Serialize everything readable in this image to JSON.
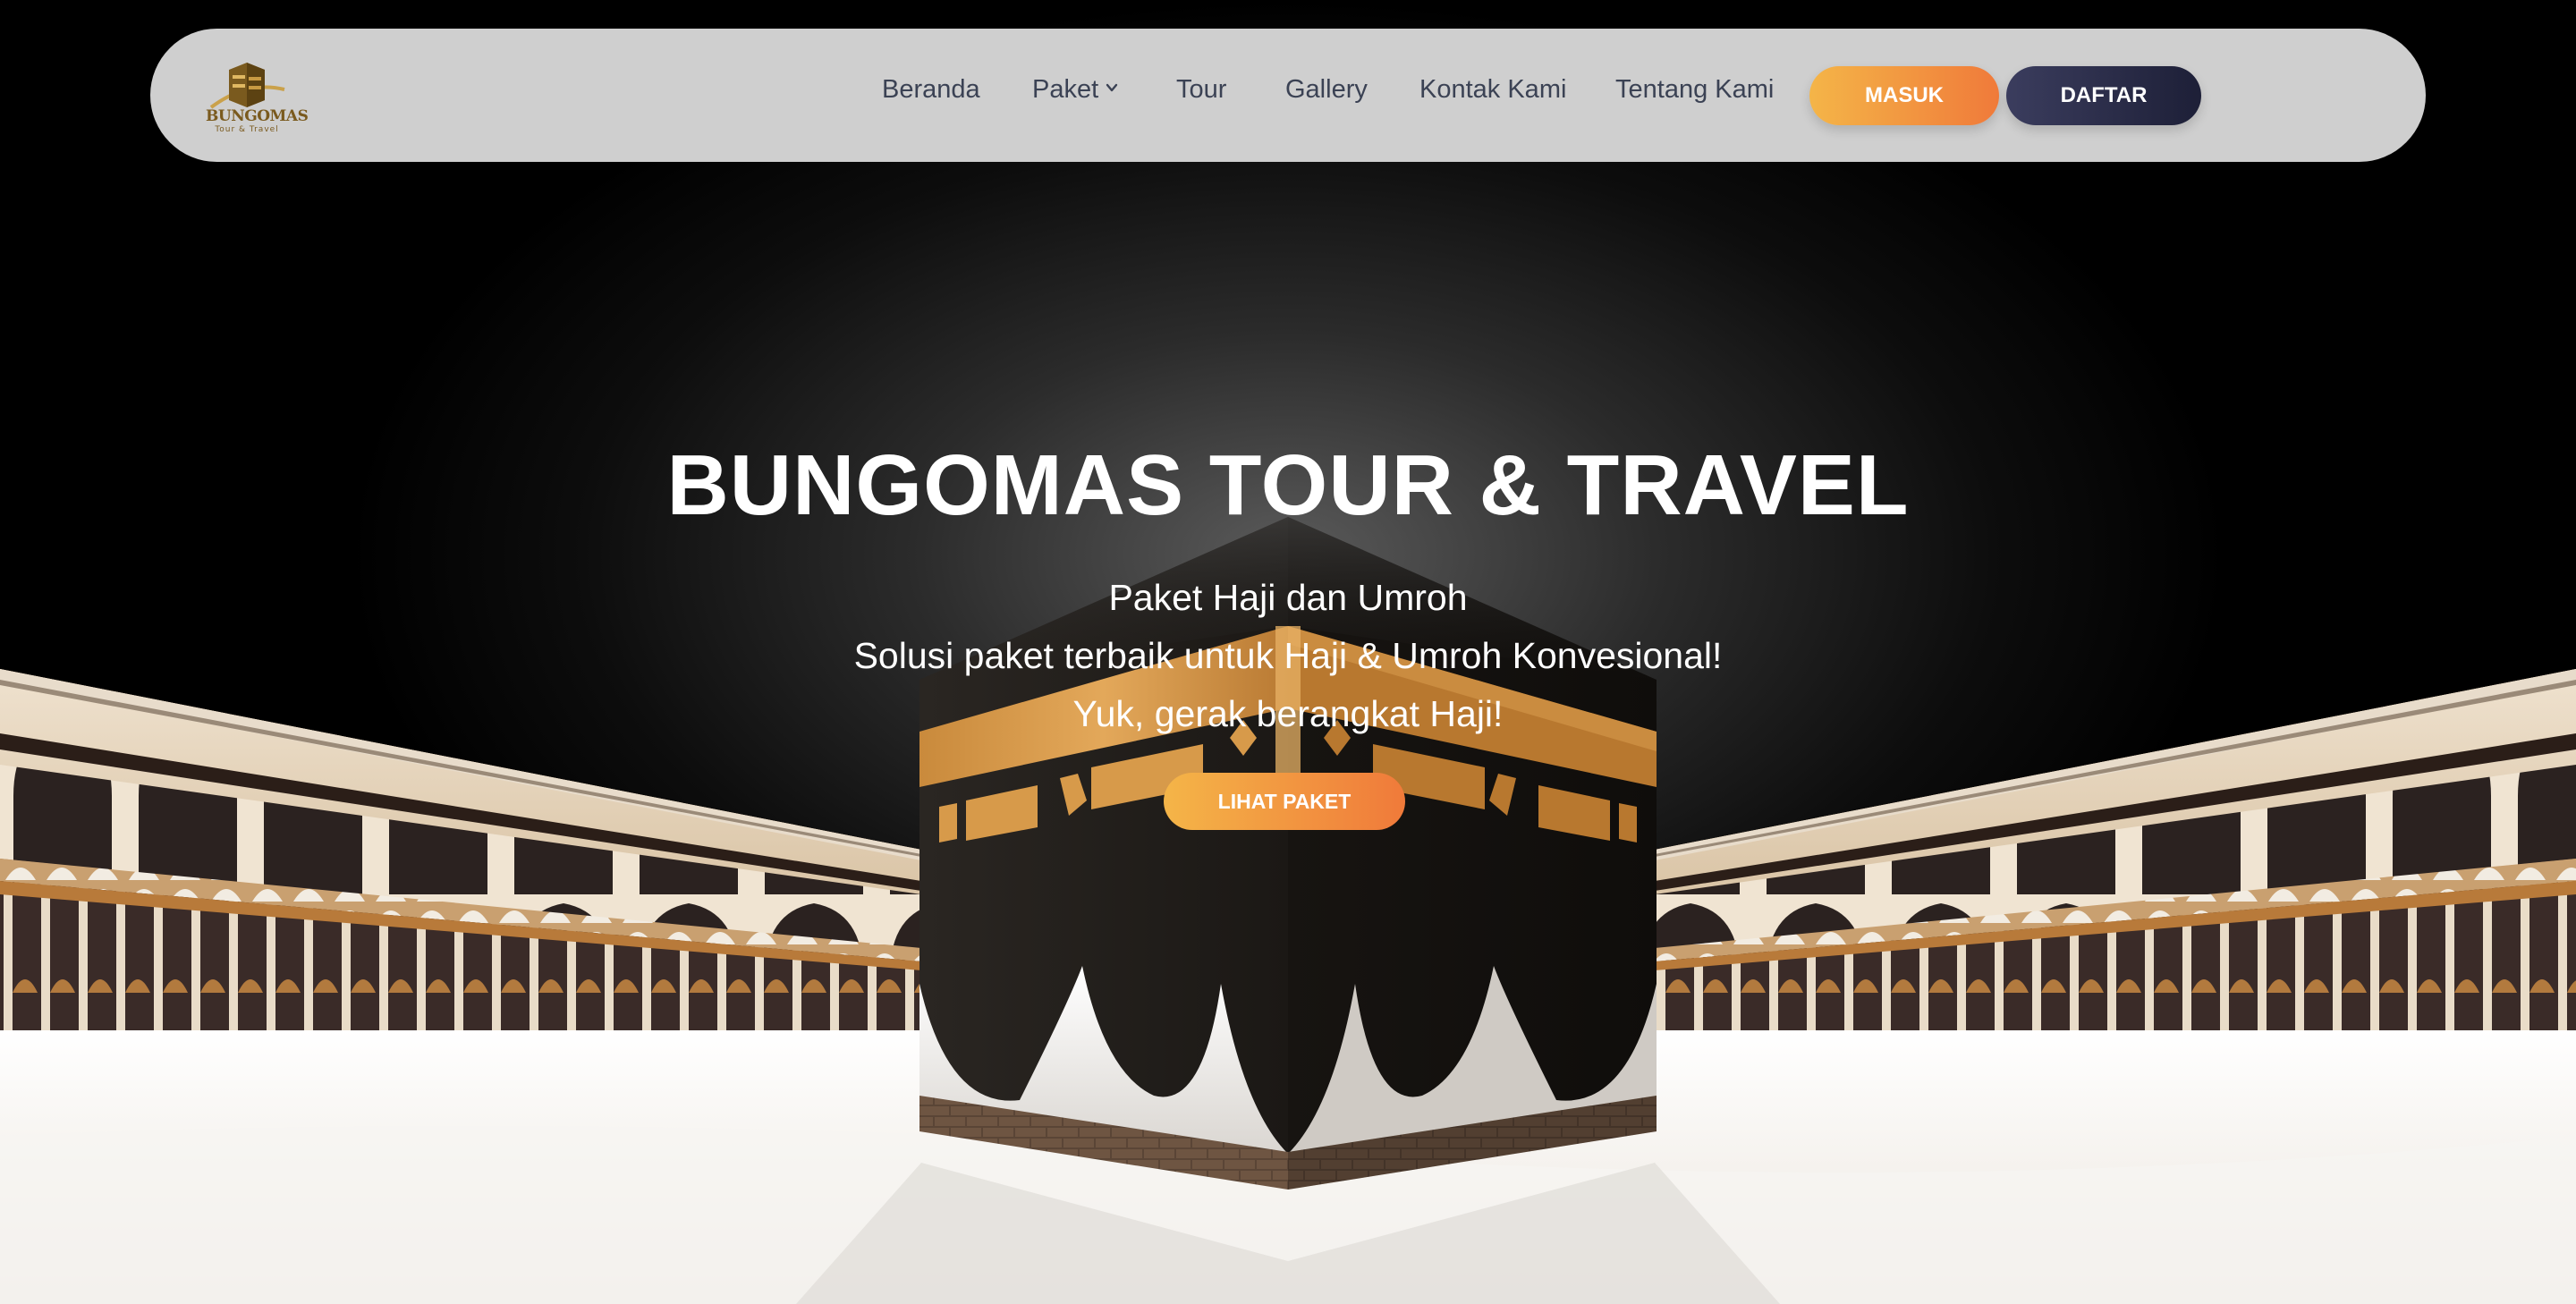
{
  "brand": {
    "logo_text": "BUNGOMAS",
    "logo_subtext": "Tour & Travel"
  },
  "nav": {
    "items": [
      {
        "label": "Beranda"
      },
      {
        "label": "Paket"
      },
      {
        "label": "Tour"
      },
      {
        "label": "Gallery"
      },
      {
        "label": "Kontak Kami"
      },
      {
        "label": "Tentang Kami"
      }
    ],
    "login_label": "MASUK",
    "register_label": "DAFTAR"
  },
  "hero": {
    "title": "BUNGOMAS TOUR & TRAVEL",
    "line1": "Paket Haji dan Umroh",
    "line2": "Solusi paket terbaik untuk Haji & Umroh Konvesional!",
    "line3": "Yuk, gerak berangkat Haji!",
    "cta_label": "LIHAT PAKET"
  },
  "colors": {
    "navbar_bg": "#cfcfcf",
    "nav_text": "#3b4254",
    "accent_orange_start": "#f4b548",
    "accent_orange_end": "#f07a3a",
    "navy_start": "#3b3d5e",
    "navy_end": "#1d1f37",
    "kaaba_black": "#1a1816",
    "kaaba_gold": "#d79a4a",
    "floor_white": "#f4f2ef"
  },
  "icons": {
    "dropdown": "chevron-down-icon",
    "logo": "kaaba-logo-icon"
  }
}
